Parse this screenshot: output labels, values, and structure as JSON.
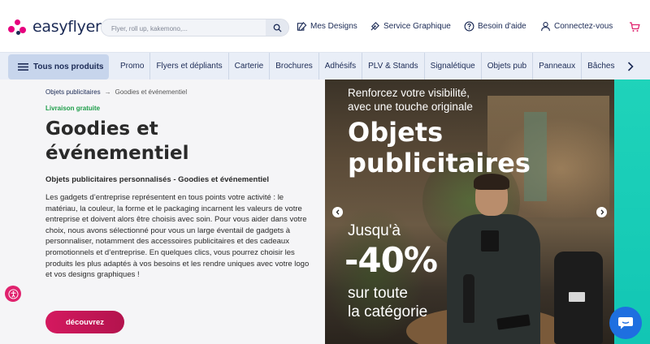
{
  "header": {
    "logo_text": "easyflyer",
    "search_placeholder": "Flyer, roll up, kakemono,...",
    "links": {
      "designs": "Mes Designs",
      "service": "Service Graphique",
      "help": "Besoin d'aide",
      "login": "Connectez-vous"
    }
  },
  "nav": {
    "all_products": "Tous nos produits",
    "items": [
      "Promo",
      "Flyers et dépliants",
      "Carterie",
      "Brochures",
      "Adhésifs",
      "PLV & Stands",
      "Signalétique",
      "Objets pub",
      "Panneaux",
      "Bâches"
    ]
  },
  "breadcrumb": {
    "parent": "Objets publicitaires",
    "separator": "→",
    "current": "Goodies et événementiel"
  },
  "main": {
    "shipping_badge": "Livraison gratuite",
    "title": "Goodies et événementiel",
    "subtitle": "Objets publicitaires personnalisés - Goodies et événementiel",
    "description": "Les gadgets d’entreprise représentent en tous points votre activité : le matériau, la couleur, la forme et le packaging incarnent les valeurs de votre entreprise et doivent alors être choisis avec soin. Pour vous aider dans votre choix, nous avons sélectionné pour vous un large éventail de gadgets à personnaliser, notamment des accessoires publicitaires et des cadeaux promotionnels et d’entreprise. En quelques clics, vous pourrez choisir les produits les plus adaptés à vos besoins et les rendre uniques avec votre logo et vos designs graphiques !",
    "cta_label": "découvrez"
  },
  "hero": {
    "tagline_line1": "Renforcez votre visibilité,",
    "tagline_line2": "avec une touche originale",
    "title_line1": "Objets",
    "title_line2": "publicitaires",
    "upto": "Jusqu'à",
    "discount": "-40%",
    "category_line1": "sur toute",
    "category_line2": "la catégorie"
  },
  "icons": {
    "search": "search-icon",
    "designs": "designs-icon",
    "service": "service-icon",
    "help": "help-icon",
    "user": "user-icon",
    "cart": "cart-icon",
    "menu": "menu-icon",
    "chevron": "chevron-right-icon",
    "accessibility": "accessibility-icon",
    "chat": "chat-icon"
  },
  "colors": {
    "brand_pink": "#e6007e",
    "navy": "#1b2a55",
    "cta": "#c4175a",
    "teal": "#1fd3ba",
    "chat": "#1e6fe0",
    "shipping_green": "#1e9e4a"
  }
}
